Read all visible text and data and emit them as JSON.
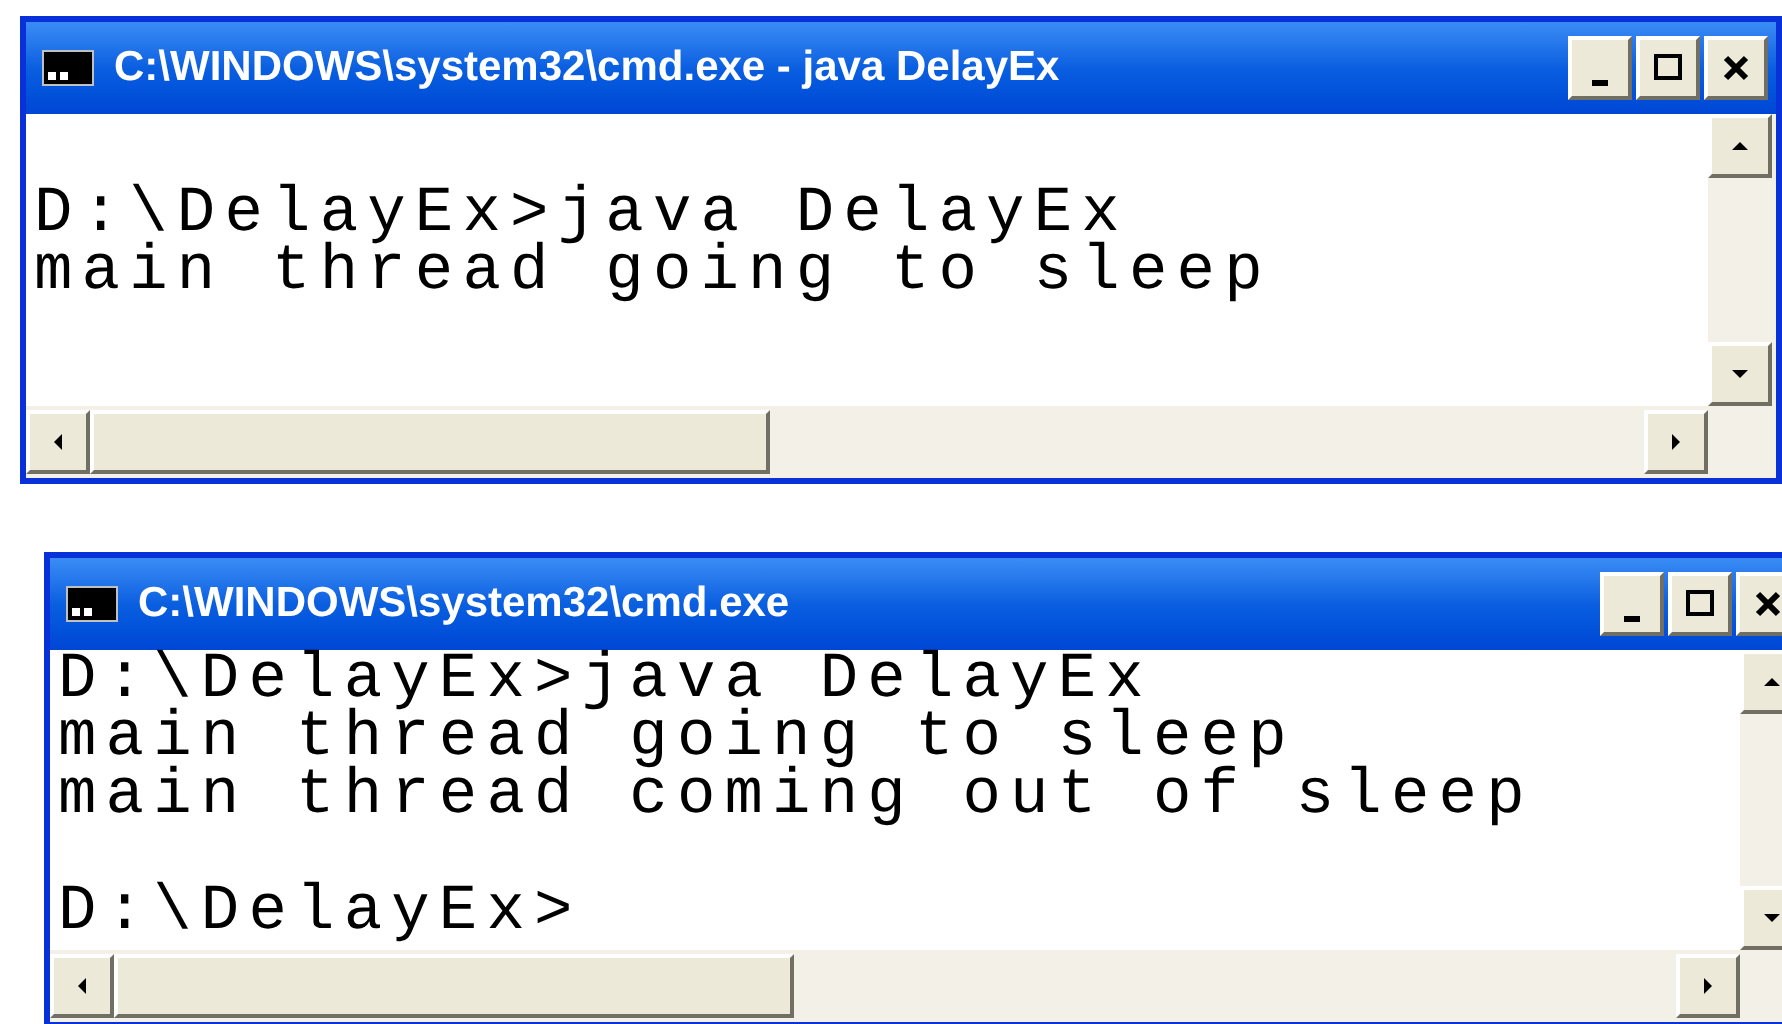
{
  "windows": [
    {
      "title": "C:\\WINDOWS\\system32\\cmd.exe - java DelayEx",
      "lines": [
        {
          "text": "D:\\DelayEx>java DelayEx",
          "blank_before": true
        },
        {
          "text": "main thread going to sleep",
          "blank_before": false
        }
      ]
    },
    {
      "title": "C:\\WINDOWS\\system32\\cmd.exe",
      "lines": [
        {
          "text": "D:\\DelayEx>java DelayEx",
          "blank_before": false
        },
        {
          "text": "main thread going to sleep",
          "blank_before": false
        },
        {
          "text": "main thread coming out of sleep",
          "blank_before": false
        },
        {
          "text": "D:\\DelayEx>",
          "blank_before": true
        }
      ]
    }
  ]
}
